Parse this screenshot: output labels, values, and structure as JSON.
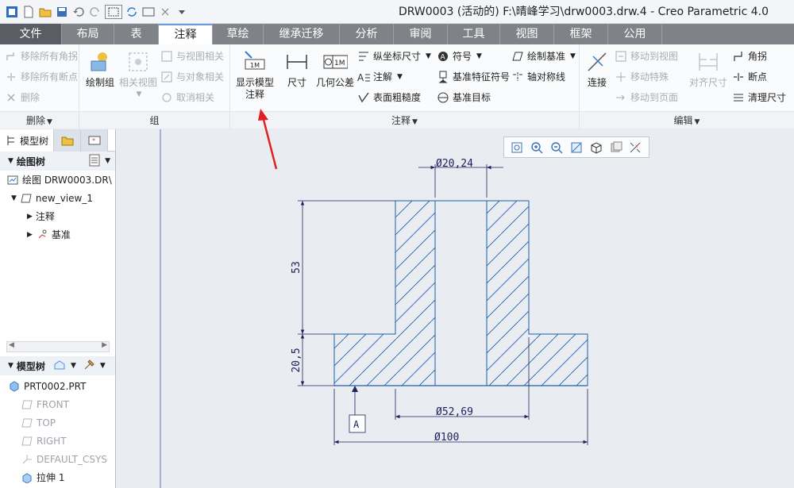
{
  "window": {
    "title": "DRW0003 (活动的) F:\\晴峰学习\\drw0003.drw.4 - Creo Parametric 4.0"
  },
  "quick_access": [
    "app-icon",
    "new-icon",
    "open-icon",
    "save-icon",
    "undo-icon",
    "redo-icon",
    "select-box-icon",
    "regenerate-icon",
    "window-icon",
    "close-window-icon",
    "more-icon"
  ],
  "tabs": [
    "文件",
    "布局",
    "表",
    "注释",
    "草绘",
    "继承迁移",
    "分析",
    "审阅",
    "工具",
    "视图",
    "框架",
    "公用"
  ],
  "ribbon": {
    "delete_group": {
      "label": "删除",
      "items": [
        "移除所有角拐",
        "移除所有断点",
        "删除"
      ]
    },
    "group_group": {
      "label": "组",
      "draw_group": "绘制组",
      "related_view": "相关视图",
      "items": [
        "与视图相关",
        "与对象相关",
        "取消相关"
      ]
    },
    "annotate_group": {
      "label": "注释",
      "show_model_annot": "显示模型注释",
      "dimension": "尺寸",
      "gtol": "几何公差",
      "gtol_icon_text": "1M",
      "show_icon_text": "1M",
      "col1": [
        "纵坐标尺寸",
        "注解",
        "表面粗糙度"
      ],
      "col2": [
        "符号",
        "基准特征符号",
        "基准目标"
      ],
      "col3": [
        "绘制基准",
        "轴对称线"
      ]
    },
    "edit_group": {
      "label": "编辑",
      "connect": "连接",
      "align_dim": "对齐尺寸",
      "col1": [
        "移动到视图",
        "移动特殊",
        "移动到页面"
      ],
      "col2": [
        "角拐",
        "断点",
        "清理尺寸"
      ]
    }
  },
  "left_pane": {
    "tab_model_tree": "模型树",
    "drawing_tree_label": "绘图树",
    "drawing_root": "绘图 DRW0003.DR\\",
    "view_node": "new_view_1",
    "children": [
      "注释",
      "基准"
    ],
    "model_tree_label": "模型树",
    "part": "PRT0002.PRT",
    "features": [
      "FRONT",
      "TOP",
      "RIGHT",
      "DEFAULT_CSYS",
      "拉伸 1"
    ]
  },
  "drawing": {
    "dims": {
      "top_dia": "Ø20,24",
      "mid_dia": "Ø52,69",
      "bottom_dia": "Ø100",
      "height_total": "53",
      "height_base": "20,5",
      "datum": "A"
    }
  },
  "colors": {
    "outline": "#1f5fa8",
    "dim": "#202060",
    "arrow": "#e02020",
    "tab_bar": "#7f8388"
  }
}
